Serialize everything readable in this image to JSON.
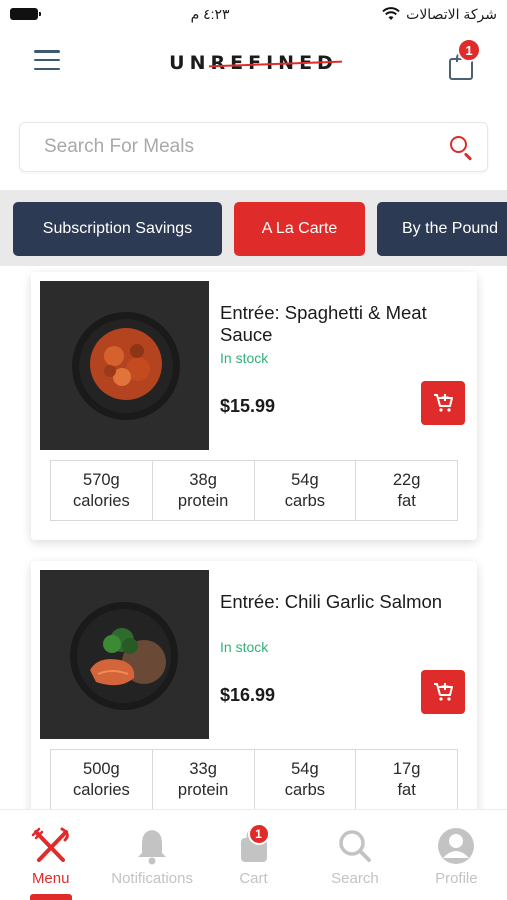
{
  "status_bar": {
    "time": "٤:٢٣ م",
    "carrier": "شركة الاتصالات"
  },
  "header": {
    "logo": {
      "prefix": "UN",
      "struck": "REFINED"
    },
    "cart_count": "1"
  },
  "search": {
    "placeholder": "Search For Meals"
  },
  "tabs": [
    {
      "label": "Subscription Savings",
      "active": false
    },
    {
      "label": "A La Carte",
      "active": true
    },
    {
      "label": "By the Pound",
      "active": false
    }
  ],
  "products": [
    {
      "title": "Entrée: Spaghetti & Meat Sauce",
      "stock": "In stock",
      "price": "$15.99",
      "nutrition": [
        {
          "value": "570g",
          "label": "calories"
        },
        {
          "value": "38g",
          "label": "protein"
        },
        {
          "value": "54g",
          "label": "carbs"
        },
        {
          "value": "22g",
          "label": "fat"
        }
      ]
    },
    {
      "title": "Entrée: Chili Garlic Salmon",
      "stock": "In stock",
      "price": "$16.99",
      "nutrition": [
        {
          "value": "500g",
          "label": "calories"
        },
        {
          "value": "33g",
          "label": "protein"
        },
        {
          "value": "54g",
          "label": "carbs"
        },
        {
          "value": "17g",
          "label": "fat"
        }
      ]
    }
  ],
  "bottom_nav": [
    {
      "label": "Menu",
      "icon": "fork-knife-icon",
      "active": true
    },
    {
      "label": "Notifications",
      "icon": "bell-icon",
      "active": false
    },
    {
      "label": "Cart",
      "icon": "bag-icon",
      "active": false,
      "badge": "1"
    },
    {
      "label": "Search",
      "icon": "search-icon",
      "active": false
    },
    {
      "label": "Profile",
      "icon": "user-icon",
      "active": false
    }
  ],
  "colors": {
    "accent": "#e02b2b",
    "navy": "#2c3a53",
    "stock": "#2fb37a",
    "inactive_nav": "#c3c3c3"
  }
}
